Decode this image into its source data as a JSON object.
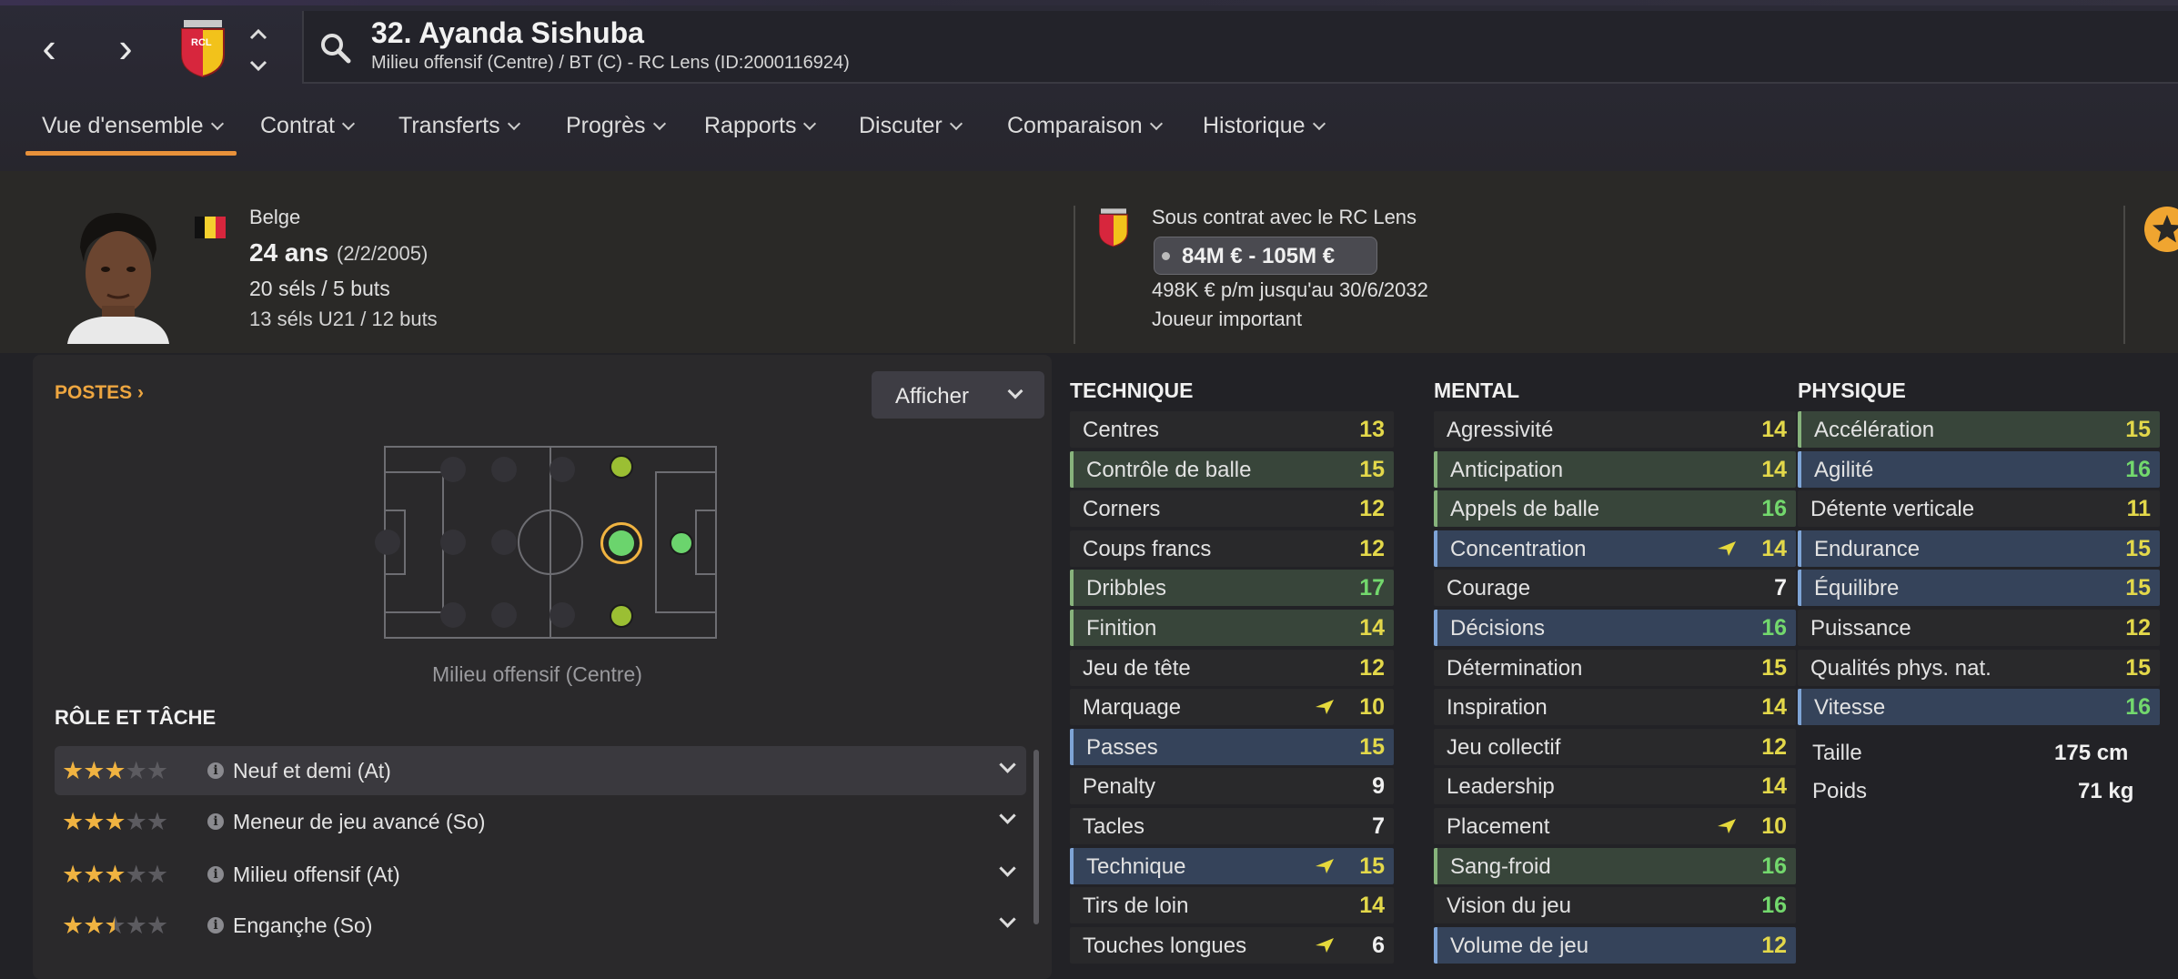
{
  "header": {
    "title": "32. Ayanda Sishuba",
    "subtitle": "Milieu offensif (Centre) / BT (C) - RC Lens (ID:2000116924)",
    "club_badge_text": "RCL"
  },
  "tabs": [
    {
      "label": "Vue d'ensemble"
    },
    {
      "label": "Contrat"
    },
    {
      "label": "Transferts"
    },
    {
      "label": "Progrès"
    },
    {
      "label": "Rapports"
    },
    {
      "label": "Discuter"
    },
    {
      "label": "Comparaison"
    },
    {
      "label": "Historique"
    }
  ],
  "profile": {
    "nationality": "Belge",
    "age": "24 ans",
    "dob": "(2/2/2005)",
    "caps": "20 séls / 5 buts",
    "caps_u21": "13 séls U21 / 12 buts",
    "flag_colors": [
      "#111111",
      "#f4d02e",
      "#d7263d"
    ]
  },
  "contract": {
    "status": "Sous contrat avec le RC Lens",
    "value": "84M € - 105M €",
    "wage": "498K € p/m jusqu'au 30/6/2032",
    "role": "Joueur important"
  },
  "positions": {
    "heading": "POSTES",
    "button": "Afficher",
    "label": "Milieu offensif (Centre)"
  },
  "roles": {
    "heading": "RÔLE ET TÂCHE",
    "items": [
      {
        "name": "Neuf et demi (At)",
        "stars": 3
      },
      {
        "name": "Meneur de jeu avancé (So)",
        "stars": 3
      },
      {
        "name": "Milieu offensif (At)",
        "stars": 3
      },
      {
        "name": "Engançhe (So)",
        "stars": 2.5
      }
    ]
  },
  "technique": {
    "heading": "TECHNIQUE",
    "rows": [
      {
        "name": "Centres",
        "value": 13,
        "hl": "",
        "arrow": false
      },
      {
        "name": "Contrôle de balle",
        "value": 15,
        "hl": "g",
        "arrow": false
      },
      {
        "name": "Corners",
        "value": 12,
        "hl": "",
        "arrow": false
      },
      {
        "name": "Coups francs",
        "value": 12,
        "hl": "",
        "arrow": false
      },
      {
        "name": "Dribbles",
        "value": 17,
        "hl": "g",
        "arrow": false
      },
      {
        "name": "Finition",
        "value": 14,
        "hl": "g",
        "arrow": false
      },
      {
        "name": "Jeu de tête",
        "value": 12,
        "hl": "",
        "arrow": false
      },
      {
        "name": "Marquage",
        "value": 10,
        "hl": "",
        "arrow": true
      },
      {
        "name": "Passes",
        "value": 15,
        "hl": "b",
        "arrow": false
      },
      {
        "name": "Penalty",
        "value": 9,
        "hl": "",
        "arrow": false
      },
      {
        "name": "Tacles",
        "value": 7,
        "hl": "",
        "arrow": false
      },
      {
        "name": "Technique",
        "value": 15,
        "hl": "b",
        "arrow": true
      },
      {
        "name": "Tirs de loin",
        "value": 14,
        "hl": "",
        "arrow": false
      },
      {
        "name": "Touches longues",
        "value": 6,
        "hl": "",
        "arrow": true
      }
    ]
  },
  "mental": {
    "heading": "MENTAL",
    "rows": [
      {
        "name": "Agressivité",
        "value": 14,
        "hl": "",
        "arrow": false
      },
      {
        "name": "Anticipation",
        "value": 14,
        "hl": "g",
        "arrow": false
      },
      {
        "name": "Appels de balle",
        "value": 16,
        "hl": "g",
        "arrow": false
      },
      {
        "name": "Concentration",
        "value": 14,
        "hl": "b",
        "arrow": true
      },
      {
        "name": "Courage",
        "value": 7,
        "hl": "",
        "arrow": false
      },
      {
        "name": "Décisions",
        "value": 16,
        "hl": "b",
        "arrow": false
      },
      {
        "name": "Détermination",
        "value": 15,
        "hl": "",
        "arrow": false
      },
      {
        "name": "Inspiration",
        "value": 14,
        "hl": "",
        "arrow": false
      },
      {
        "name": "Jeu collectif",
        "value": 12,
        "hl": "",
        "arrow": false
      },
      {
        "name": "Leadership",
        "value": 14,
        "hl": "",
        "arrow": false
      },
      {
        "name": "Placement",
        "value": 10,
        "hl": "",
        "arrow": true
      },
      {
        "name": "Sang-froid",
        "value": 16,
        "hl": "g",
        "arrow": false
      },
      {
        "name": "Vision du jeu",
        "value": 16,
        "hl": "",
        "arrow": false
      },
      {
        "name": "Volume de jeu",
        "value": 12,
        "hl": "b",
        "arrow": false
      }
    ]
  },
  "physique": {
    "heading": "PHYSIQUE",
    "rows": [
      {
        "name": "Accélération",
        "value": 15,
        "hl": "g",
        "arrow": false
      },
      {
        "name": "Agilité",
        "value": 16,
        "hl": "b",
        "arrow": false
      },
      {
        "name": "Détente verticale",
        "value": 11,
        "hl": "",
        "arrow": false
      },
      {
        "name": "Endurance",
        "value": 15,
        "hl": "b",
        "arrow": false
      },
      {
        "name": "Équilibre",
        "value": 15,
        "hl": "b",
        "arrow": false
      },
      {
        "name": "Puissance",
        "value": 12,
        "hl": "",
        "arrow": false
      },
      {
        "name": "Qualités phys. nat.",
        "value": 15,
        "hl": "",
        "arrow": false
      },
      {
        "name": "Vitesse",
        "value": 16,
        "hl": "b",
        "arrow": false
      }
    ],
    "height_label": "Taille",
    "height": "175 cm",
    "weight_label": "Poids",
    "weight": "71 kg"
  }
}
